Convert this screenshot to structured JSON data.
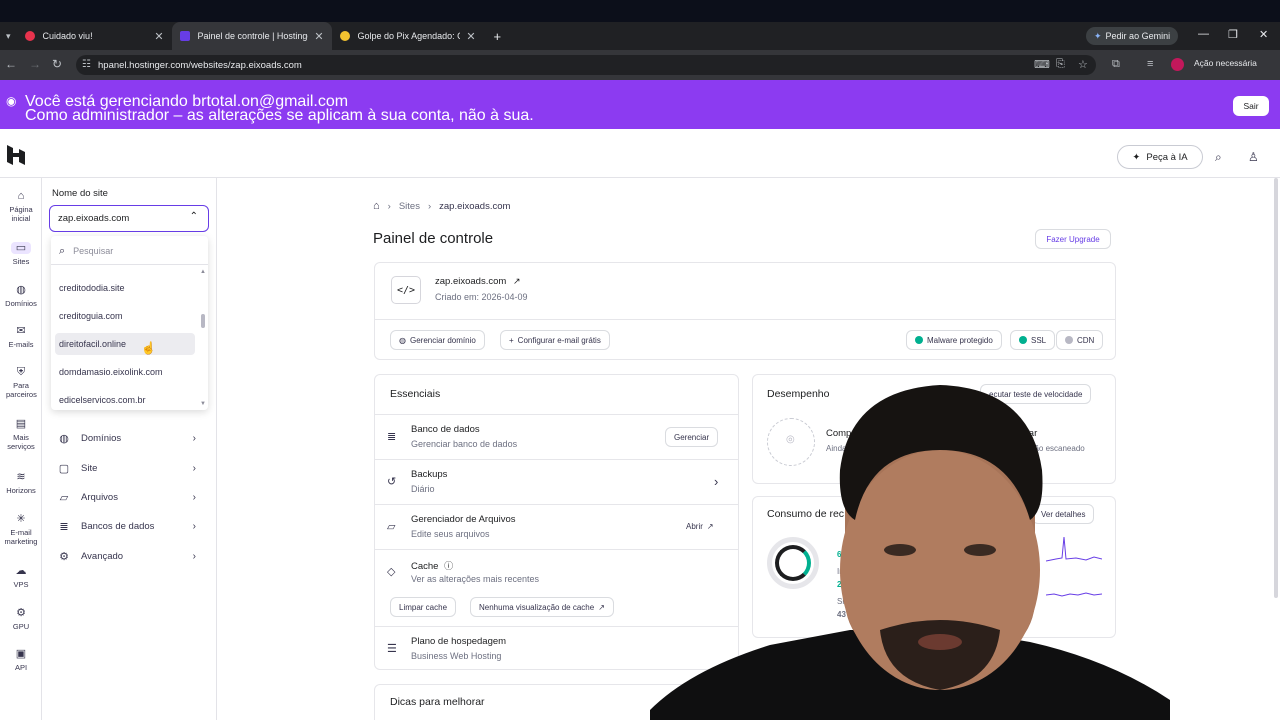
{
  "browser": {
    "tabs": [
      {
        "title": "Cuidado viu!",
        "fav": "#e8334d",
        "active": false
      },
      {
        "title": "Painel de controle | Hostinger",
        "fav": "#673de6",
        "active": true
      },
      {
        "title": "Golpe do Pix Agendado: Como",
        "fav": "#f2c230",
        "active": false
      }
    ],
    "new_tab": "+",
    "gemini": "Pedir ao Gemini",
    "url": "hpanel.hostinger.com/websites/zap.eixoads.com",
    "action_required": "Ação necessária"
  },
  "banner": {
    "line1": "Você está gerenciando brtotal.on@gmail.com",
    "line2": "Como administrador – as alterações se aplicam à sua conta, não à sua.",
    "exit": "Sair"
  },
  "header": {
    "ask_ai": "Peça à IA"
  },
  "rail": [
    {
      "icon": "home-icon",
      "glyph": "⌂",
      "label": "Página inicial"
    },
    {
      "icon": "sites-icon",
      "glyph": "▭",
      "label": "Sites"
    },
    {
      "icon": "globe-icon",
      "glyph": "◍",
      "label": "Domínios"
    },
    {
      "icon": "mail-icon",
      "glyph": "✉",
      "label": "E-mails"
    },
    {
      "icon": "partners-icon",
      "glyph": "⛨",
      "label": "Para parceiros"
    },
    {
      "icon": "services-icon",
      "glyph": "▤",
      "label": "Mais serviços"
    },
    {
      "icon": "horizons-icon",
      "glyph": "≋",
      "label": "Horizons"
    },
    {
      "icon": "email-marketing-icon",
      "glyph": "✳",
      "label": "E-mail marketing"
    },
    {
      "icon": "vps-icon",
      "glyph": "☁",
      "label": "VPS"
    },
    {
      "icon": "gpu-icon",
      "glyph": "⚙",
      "label": "GPU"
    },
    {
      "icon": "api-icon",
      "glyph": "▣",
      "label": "API"
    }
  ],
  "sidebar": {
    "label": "Nome do site",
    "selected": "zap.eixoads.com",
    "search_placeholder": "Pesquisar",
    "options": [
      "creditododia.site",
      "creditoguia.com",
      "direitofacil.online",
      "domdamasio.eixolink.com",
      "edicelservicos.com.br"
    ],
    "nav": [
      {
        "icon": "globe-icon",
        "glyph": "◍",
        "label": "Domínios"
      },
      {
        "icon": "site-icon",
        "glyph": "▢",
        "label": "Site"
      },
      {
        "icon": "folder-icon",
        "glyph": "▱",
        "label": "Arquivos"
      },
      {
        "icon": "database-icon",
        "glyph": "≣",
        "label": "Bancos de dados"
      },
      {
        "icon": "settings-icon",
        "glyph": "⚙",
        "label": "Avançado"
      }
    ]
  },
  "main": {
    "breadcrumb": [
      "Sites",
      "zap.eixoads.com"
    ],
    "title": "Painel de controle",
    "upgrade": "Fazer Upgrade",
    "site": {
      "name": "zap.eixoads.com",
      "created": "Criado em: 2026-04-09",
      "manage_domain": "Gerenciar domínio",
      "config_email": "Configurar e-mail grátis",
      "badges": [
        "Malware protegido",
        "SSL",
        "CDN"
      ]
    },
    "essentials": {
      "title": "Essenciais",
      "rows": [
        {
          "icon": "database-icon",
          "glyph": "≣",
          "title": "Banco de dados",
          "sub": "Gerenciar banco de dados",
          "action": "Gerenciar"
        },
        {
          "icon": "backup-icon",
          "glyph": "↺",
          "title": "Backups",
          "sub": "Diário",
          "action": "›"
        },
        {
          "icon": "folder-icon",
          "glyph": "▱",
          "title": "Gerenciador de Arquivos",
          "sub": "Edite seus arquivos",
          "action": "Abrir"
        },
        {
          "icon": "cache-icon",
          "glyph": "◇",
          "title": "Cache",
          "sub": "Ver as alterações mais recentes",
          "btn1": "Limpar cache",
          "btn2": "Nenhuma visualização de cache"
        },
        {
          "icon": "hosting-icon",
          "glyph": "☰",
          "title": "Plano de hospedagem",
          "sub": "Business Web Hosting"
        }
      ]
    },
    "tips": "Dicas para melhorar",
    "performance": {
      "title": "Desempenho",
      "test": "ecutar teste de velocidade",
      "comp": "Comp",
      "comp_sub": "Ainda",
      "mobile": "elular",
      "mobile_sub": "não escaneado"
    },
    "resources": {
      "title": "Consumo de rec",
      "details": "Ver detalhes",
      "labels": [
        "Inod",
        "Sites"
      ],
      "values": [
        "6",
        "268",
        "43"
      ],
      "tail": "res"
    }
  }
}
